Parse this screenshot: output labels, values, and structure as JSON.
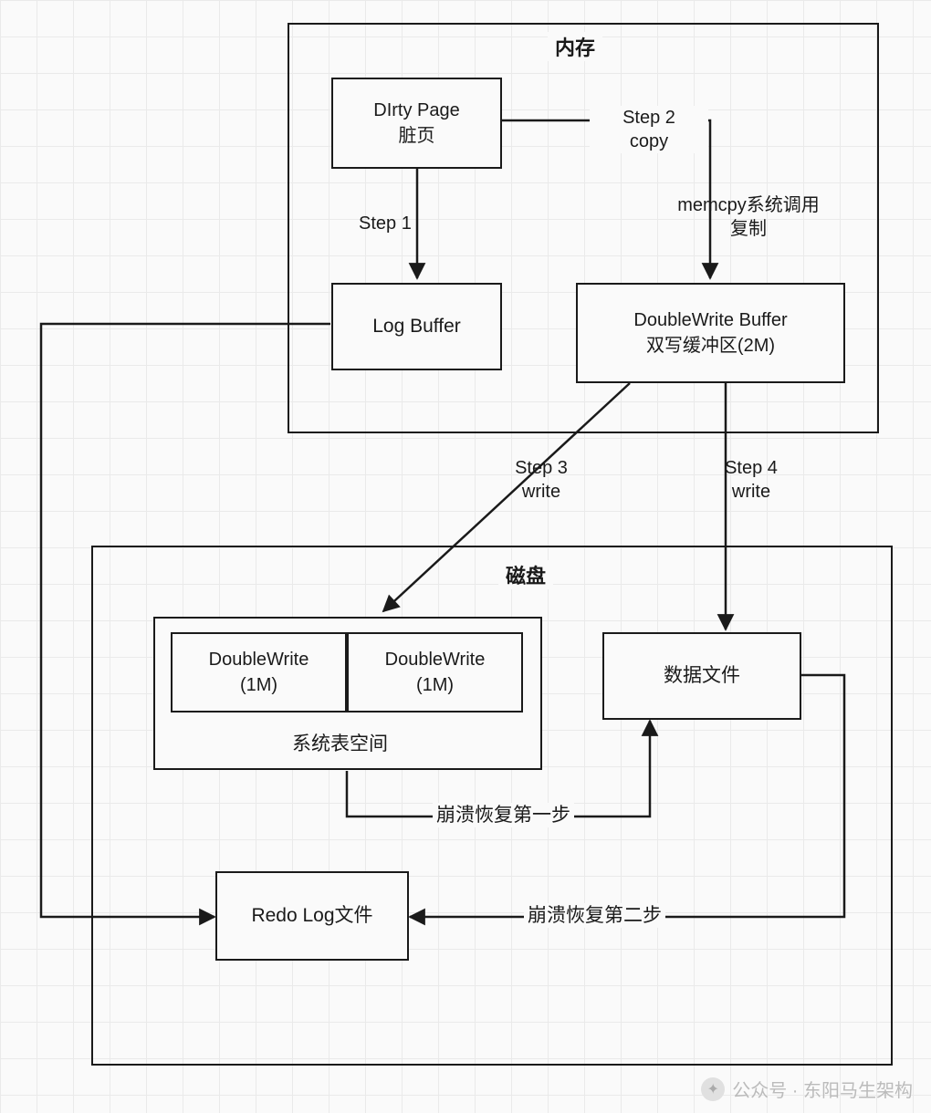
{
  "memory": {
    "title": "内存",
    "dirty_page_l1": "DIrty Page",
    "dirty_page_l2": "脏页",
    "log_buffer": "Log Buffer",
    "dw_buffer_l1": "DoubleWrite Buffer",
    "dw_buffer_l2": "双写缓冲区(2M)",
    "step1": "Step 1",
    "step2_l1": "Step 2",
    "step2_l2": "copy",
    "memcpy_l1": "memcpy系统调用",
    "memcpy_l2": "复制"
  },
  "between": {
    "step3_l1": "Step 3",
    "step3_l2": "write",
    "step4_l1": "Step 4",
    "step4_l2": "write"
  },
  "disk": {
    "title": "磁盘",
    "sys_tablespace": "系统表空间",
    "dw1_l1": "DoubleWrite",
    "dw1_l2": "(1M)",
    "dw2_l1": "DoubleWrite",
    "dw2_l2": "(1M)",
    "data_file": "数据文件",
    "redo_log": "Redo Log文件",
    "crash1": "崩溃恢复第一步",
    "crash2": "崩溃恢复第二步"
  },
  "watermark": {
    "text": "公众号 · 东阳马生架构"
  }
}
